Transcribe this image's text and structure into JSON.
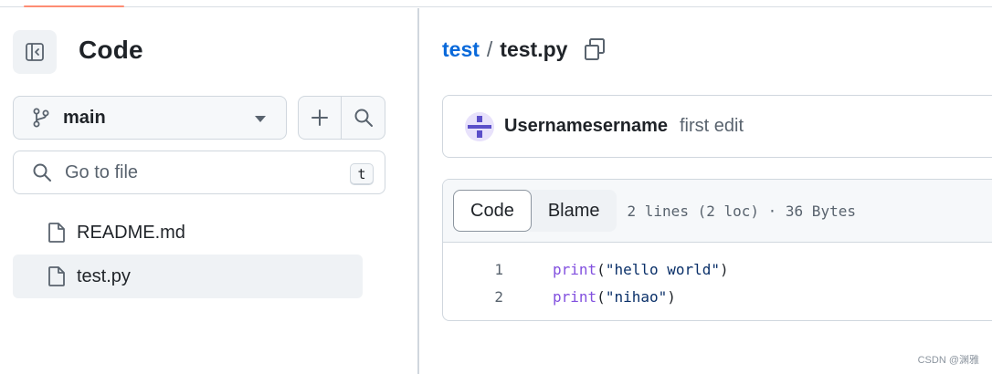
{
  "sidebar": {
    "title": "Code",
    "branch": {
      "label": "main"
    },
    "search": {
      "placeholder": "Go to file",
      "shortcut": "t"
    },
    "files": [
      {
        "label": "README.md",
        "active": false
      },
      {
        "label": "test.py",
        "active": true
      }
    ]
  },
  "main": {
    "breadcrumb": {
      "repo": "test",
      "separator": "/",
      "file": "test.py"
    },
    "commit": {
      "author": "Usernamesername",
      "message": "first edit"
    },
    "file_view": {
      "tabs": [
        {
          "label": "Code",
          "selected": true
        },
        {
          "label": "Blame",
          "selected": false
        }
      ],
      "meta": "2 lines (2 loc) · 36 Bytes",
      "lines": [
        {
          "num": "1",
          "func": "print",
          "open": "(",
          "arg": "\"hello world\"",
          "close": ")"
        },
        {
          "num": "2",
          "func": "print",
          "open": "(",
          "arg": "\"nihao\"",
          "close": ")"
        }
      ]
    }
  },
  "watermark": "CSDN @渊雅",
  "colors": {
    "link": "#0969da",
    "keyword": "#8250df",
    "string": "#0a3069",
    "accent": "#fd8c73"
  }
}
